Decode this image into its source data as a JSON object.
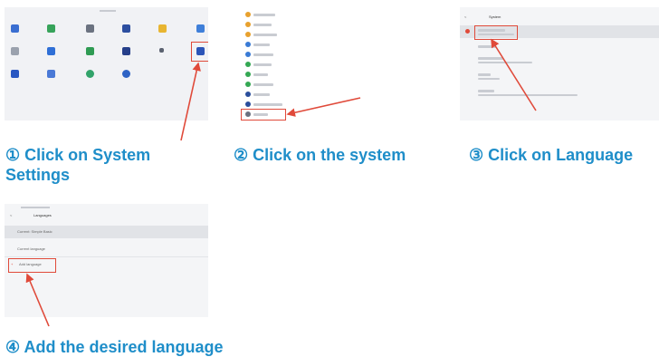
{
  "steps": [
    {
      "caption_line1": "① Click on System",
      "caption_line2": "Settings"
    },
    {
      "caption": "② Click on the system"
    },
    {
      "caption": "③ Click on Language"
    },
    {
      "caption": "④ Add the desired language"
    }
  ],
  "thumb3": {
    "title": "System"
  },
  "thumb4": {
    "title": "Languages",
    "row1": "Current: Simple Basic",
    "row2": "Current language",
    "add": "Add language"
  },
  "colors": {
    "caption": "#1f8ec9",
    "highlight": "#e04a3a"
  }
}
